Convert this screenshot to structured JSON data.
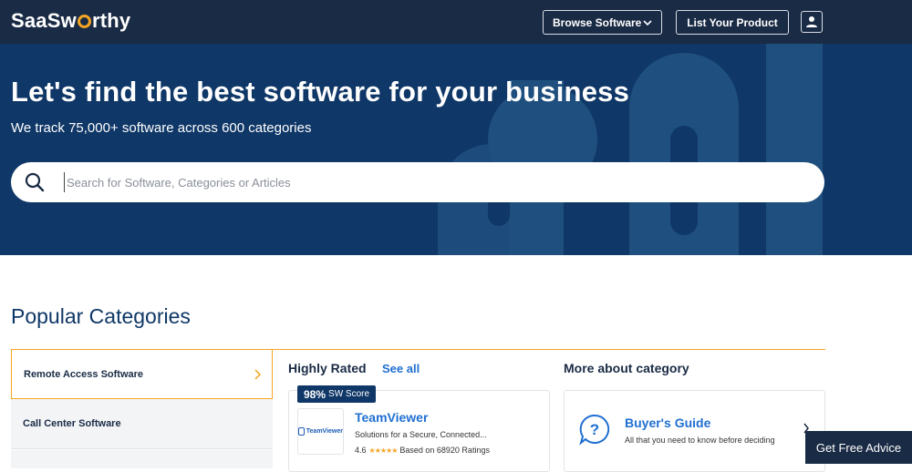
{
  "header": {
    "logo_pre": "SaaSw",
    "logo_post": "rthy",
    "browse_label": "Browse Software",
    "list_label": "List Your Product"
  },
  "hero": {
    "title": "Let's find the best software for your business",
    "subtitle": "We track 75,000+ software across 600 categories",
    "search_placeholder": "Search for Software, Categories or Articles"
  },
  "popular": {
    "title": "Popular Categories",
    "categories": [
      {
        "label": "Remote Access Software"
      },
      {
        "label": "Call Center Software"
      }
    ]
  },
  "highly_rated": {
    "title": "Highly Rated",
    "see_all": "See all",
    "product": {
      "score_pct": "98%",
      "score_label": "SW Score",
      "logo_text": "TeamViewer",
      "name": "TeamViewer",
      "description": "Solutions for a Secure, Connected...",
      "rating": "4.6",
      "stars": "★★★★★",
      "ratings_text": "Based on 68920 Ratings"
    }
  },
  "more": {
    "title": "More about category",
    "guide_title": "Buyer's Guide",
    "guide_desc": "All that you need to know before deciding"
  },
  "advice_label": "Get Free Advice",
  "colors": {
    "header_bg": "#1a2b45",
    "hero_bg": "#0f3767",
    "accent": "#f5a524",
    "link": "#1f6fd1"
  }
}
